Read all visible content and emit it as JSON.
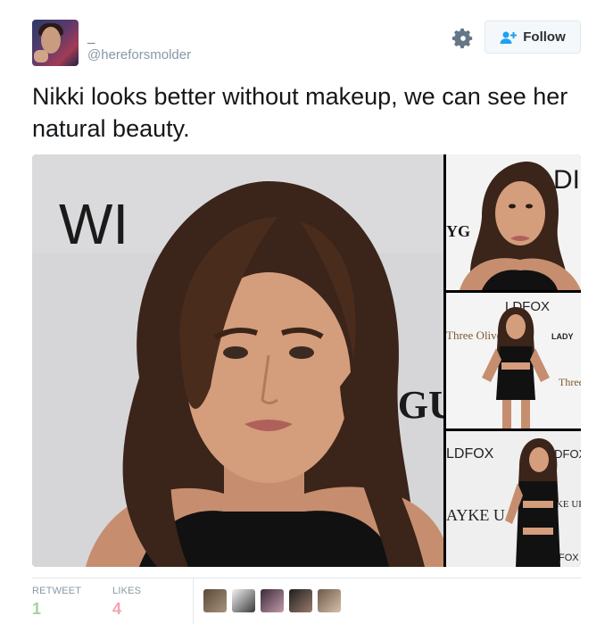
{
  "author": {
    "display_name": "_",
    "handle": "@hereforsmolder"
  },
  "actions": {
    "follow_label": "Follow"
  },
  "tweet": {
    "text": "Nikki looks better without makeup, we can see her natural beauty."
  },
  "media": {
    "main_sign": "WI",
    "main_sign2": "YGU",
    "thumb1_sign": "ILDI",
    "thumb1_sign2": "YG",
    "thumb2_sign": "LDFOX",
    "thumb2_brand": "Three Olives",
    "thumb2_brand2": "Three",
    "thumb2_lady": "LADY",
    "thumb3_sign": "LDFOX",
    "thumb3_sign2": "WILDFOX",
    "thumb3_sign3": "AYKE U",
    "thumb3_sign4": "AKE UP",
    "thumb3_sign5": "FOX"
  },
  "stats": {
    "retweet_label": "RETWEET",
    "retweet_count": "1",
    "likes_label": "LIKES",
    "likes_count": "4"
  },
  "colors": {
    "follow_icon": "#1da1f2",
    "retweet_count": "#a3d39c",
    "likes_count": "#f3a4b0",
    "secondary_text": "#8899a6"
  },
  "icons": {
    "gear": "gear-icon",
    "follow": "follow-person-plus-icon"
  }
}
